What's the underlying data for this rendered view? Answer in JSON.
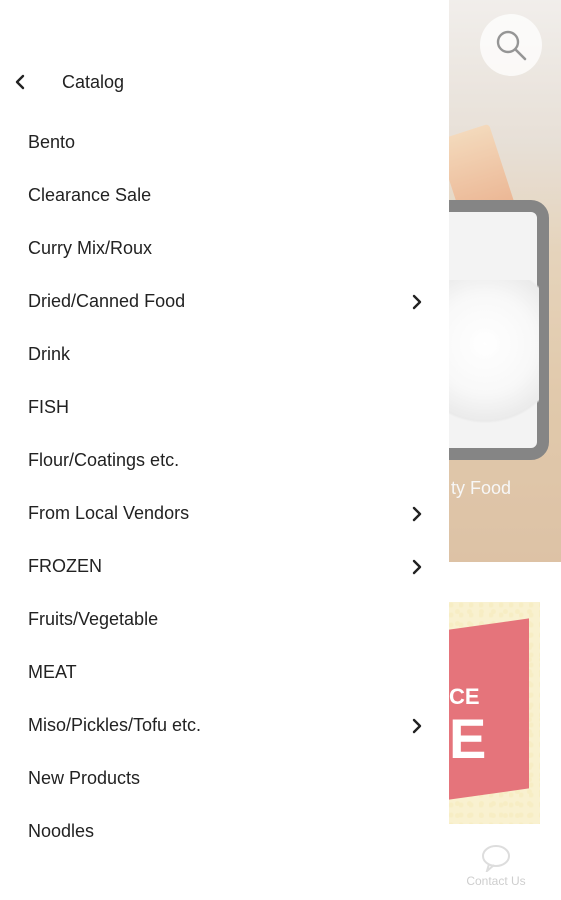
{
  "header": {
    "title": "Catalog",
    "back_icon": "chevron-left-icon"
  },
  "categories": [
    {
      "label": "Bento",
      "has_children": false
    },
    {
      "label": "Clearance Sale",
      "has_children": false
    },
    {
      "label": "Curry Mix/Roux",
      "has_children": false
    },
    {
      "label": "Dried/Canned Food",
      "has_children": true
    },
    {
      "label": "Drink",
      "has_children": false
    },
    {
      "label": "FISH",
      "has_children": false
    },
    {
      "label": "Flour/Coatings etc.",
      "has_children": false
    },
    {
      "label": "From Local Vendors",
      "has_children": true
    },
    {
      "label": "FROZEN",
      "has_children": true
    },
    {
      "label": "Fruits/Vegetable",
      "has_children": false
    },
    {
      "label": "MEAT",
      "has_children": false
    },
    {
      "label": "Miso/Pickles/Tofu etc.",
      "has_children": true
    },
    {
      "label": "New Products",
      "has_children": false
    },
    {
      "label": "Noodles",
      "has_children": false
    }
  ],
  "background": {
    "hero_caption": "ty Food",
    "banner_text_1": "CE",
    "banner_text_2": "E",
    "contact_label": "Contact Us",
    "search_icon": "search-icon"
  },
  "colors": {
    "text": "#222222",
    "banner_red": "#d6202a",
    "banner_yellow": "#f5e9b4"
  }
}
